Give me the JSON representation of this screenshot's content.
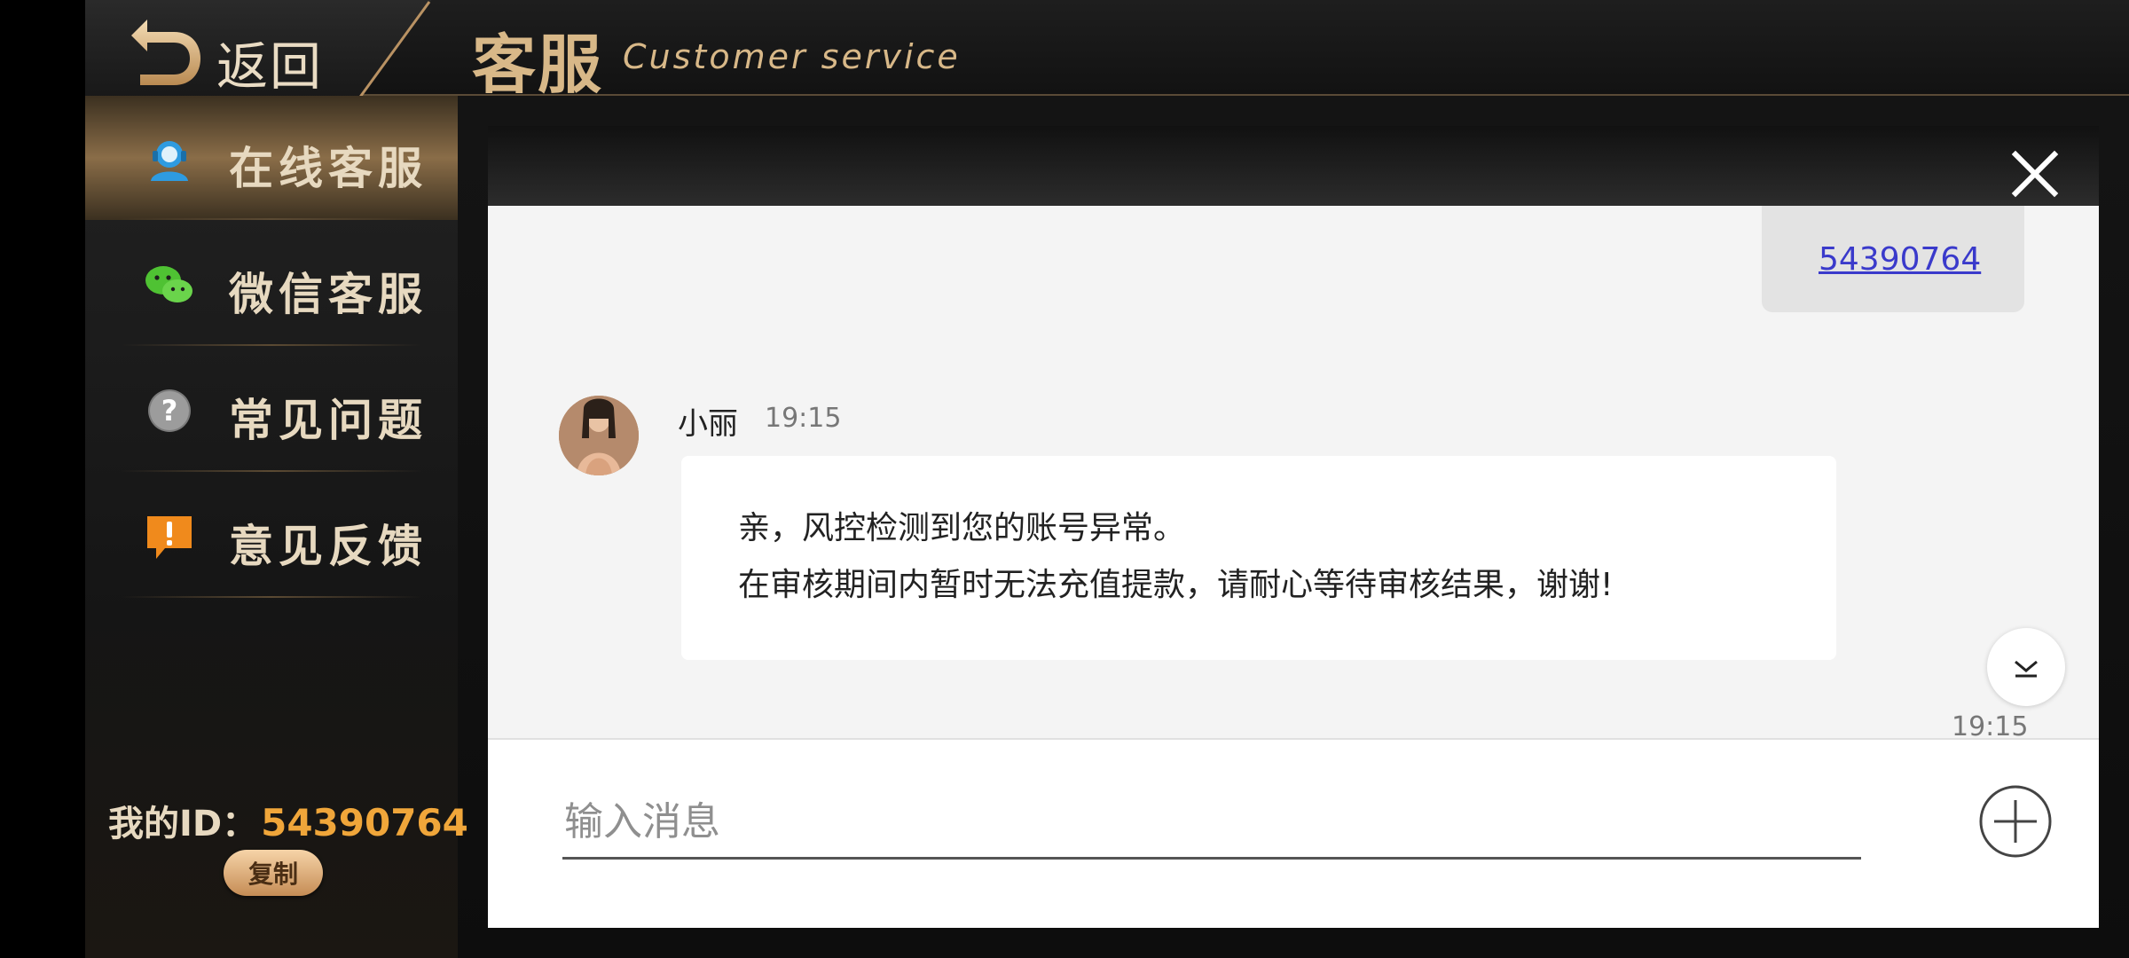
{
  "header": {
    "back_label": "返回",
    "title": "客服",
    "subtitle": "Customer service"
  },
  "sidebar": {
    "items": [
      {
        "label": "在线客服",
        "icon": "headset-icon",
        "active": true
      },
      {
        "label": "微信客服",
        "icon": "wechat-icon",
        "active": false
      },
      {
        "label": "常见问题",
        "icon": "question-icon",
        "active": false
      },
      {
        "label": "意见反馈",
        "icon": "feedback-icon",
        "active": false
      }
    ],
    "id_label": "我的ID：",
    "id_value": "54390764",
    "copy_label": "复制"
  },
  "chat": {
    "sent_message": "54390764",
    "received": {
      "sender": "小丽",
      "time": "19:15",
      "line1": "亲，风控检测到您的账号异常。",
      "line2": "在审核期间内暂时无法充值提款，请耐心等待审核结果，谢谢!"
    },
    "bottom_time": "19:15",
    "input_placeholder": "输入消息"
  },
  "colors": {
    "accent_gold": "#d8b888",
    "id_orange": "#f0a63a",
    "link_blue": "#3a3acb"
  }
}
